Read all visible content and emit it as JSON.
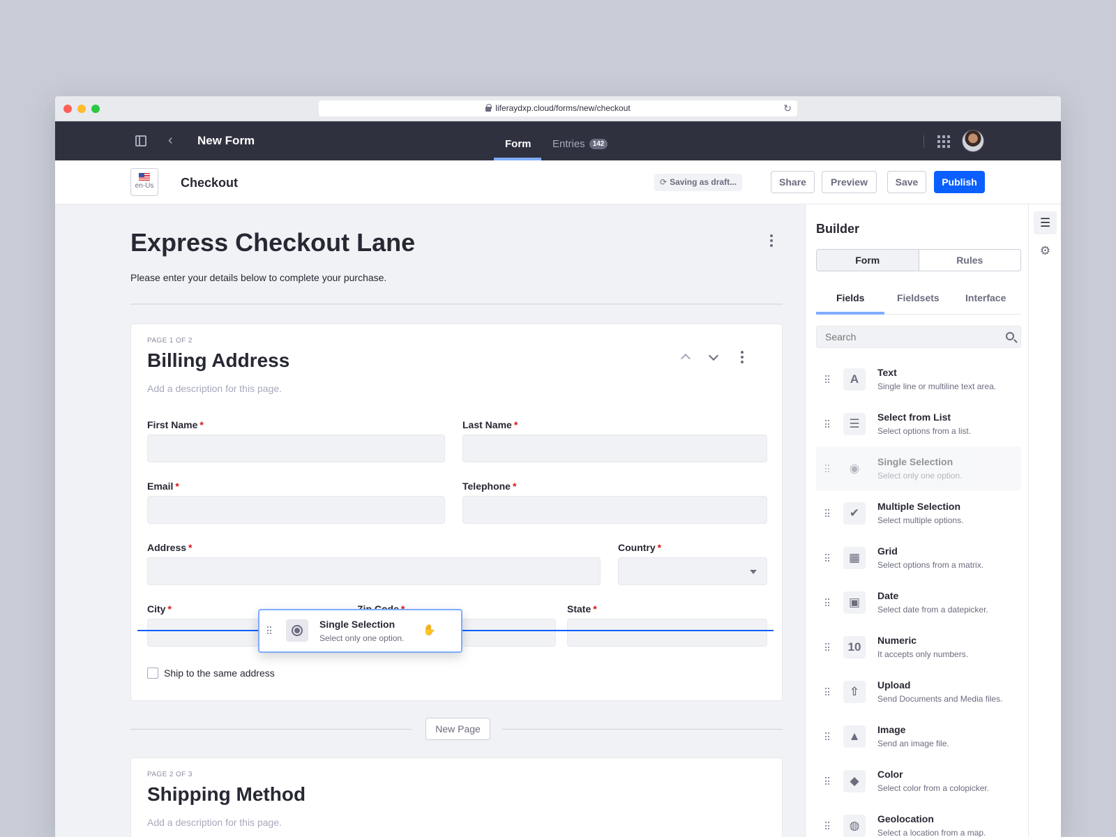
{
  "browser": {
    "url": "liferaydxp.cloud/forms/new/checkout"
  },
  "appbar": {
    "title": "New Form",
    "tabs": [
      {
        "label": "Form"
      },
      {
        "label": "Entries",
        "count": "142"
      }
    ]
  },
  "toolbar": {
    "locale": "en-Us",
    "title": "Checkout",
    "status": "Saving as draft...",
    "share": "Share",
    "preview": "Preview",
    "save": "Save",
    "publish": "Publish"
  },
  "form": {
    "title": "Express Checkout Lane",
    "description": "Please enter your details below to complete your purchase.",
    "pages": [
      {
        "number": "PAGE 1 OF 2",
        "title": "Billing Address",
        "description": "Add a description for this page.",
        "fields": {
          "first_name": "First Name",
          "last_name": "Last Name",
          "email": "Email",
          "telephone": "Telephone",
          "address": "Address",
          "country": "Country",
          "city": "City",
          "zip": "Zip Code",
          "state": "State"
        },
        "required_mark": "*",
        "checkbox": "Ship to the same address"
      },
      {
        "number": "PAGE 2 OF 3",
        "title": "Shipping Method",
        "description": "Add a description for this page."
      }
    ],
    "new_page": "New Page",
    "drag_ghost": {
      "name": "Single Selection",
      "desc": "Select only one option."
    }
  },
  "builder": {
    "title": "Builder",
    "segments": [
      "Form",
      "Rules"
    ],
    "tabs": [
      "Fields",
      "Fieldsets",
      "Interface"
    ],
    "search_placeholder": "Search",
    "fields": [
      {
        "name": "Text",
        "desc": "Single line or multiline text area.",
        "icon": "text-icon",
        "glyph": "A"
      },
      {
        "name": "Select from List",
        "desc": "Select options from a list.",
        "icon": "list-icon",
        "glyph": "☰"
      },
      {
        "name": "Single Selection",
        "desc": "Select only one option.",
        "icon": "radio-icon",
        "glyph": "◉"
      },
      {
        "name": "Multiple Selection",
        "desc": "Select multiple options.",
        "icon": "check-circle-icon",
        "glyph": "✔"
      },
      {
        "name": "Grid",
        "desc": "Select options from a matrix.",
        "icon": "grid-icon",
        "glyph": "▦"
      },
      {
        "name": "Date",
        "desc": "Select date from a datepicker.",
        "icon": "calendar-icon",
        "glyph": "▣"
      },
      {
        "name": "Numeric",
        "desc": "It accepts only numbers.",
        "icon": "numeric-icon",
        "glyph": "10"
      },
      {
        "name": "Upload",
        "desc": "Send Documents and Media files.",
        "icon": "upload-icon",
        "glyph": "⇧"
      },
      {
        "name": "Image",
        "desc": "Send an image file.",
        "icon": "image-icon",
        "glyph": "▲"
      },
      {
        "name": "Color",
        "desc": "Select color from a colopicker.",
        "icon": "paint-bucket-icon",
        "glyph": "◆"
      },
      {
        "name": "Geolocation",
        "desc": "Select a location from a map.",
        "icon": "globe-icon",
        "glyph": "◍"
      }
    ]
  }
}
